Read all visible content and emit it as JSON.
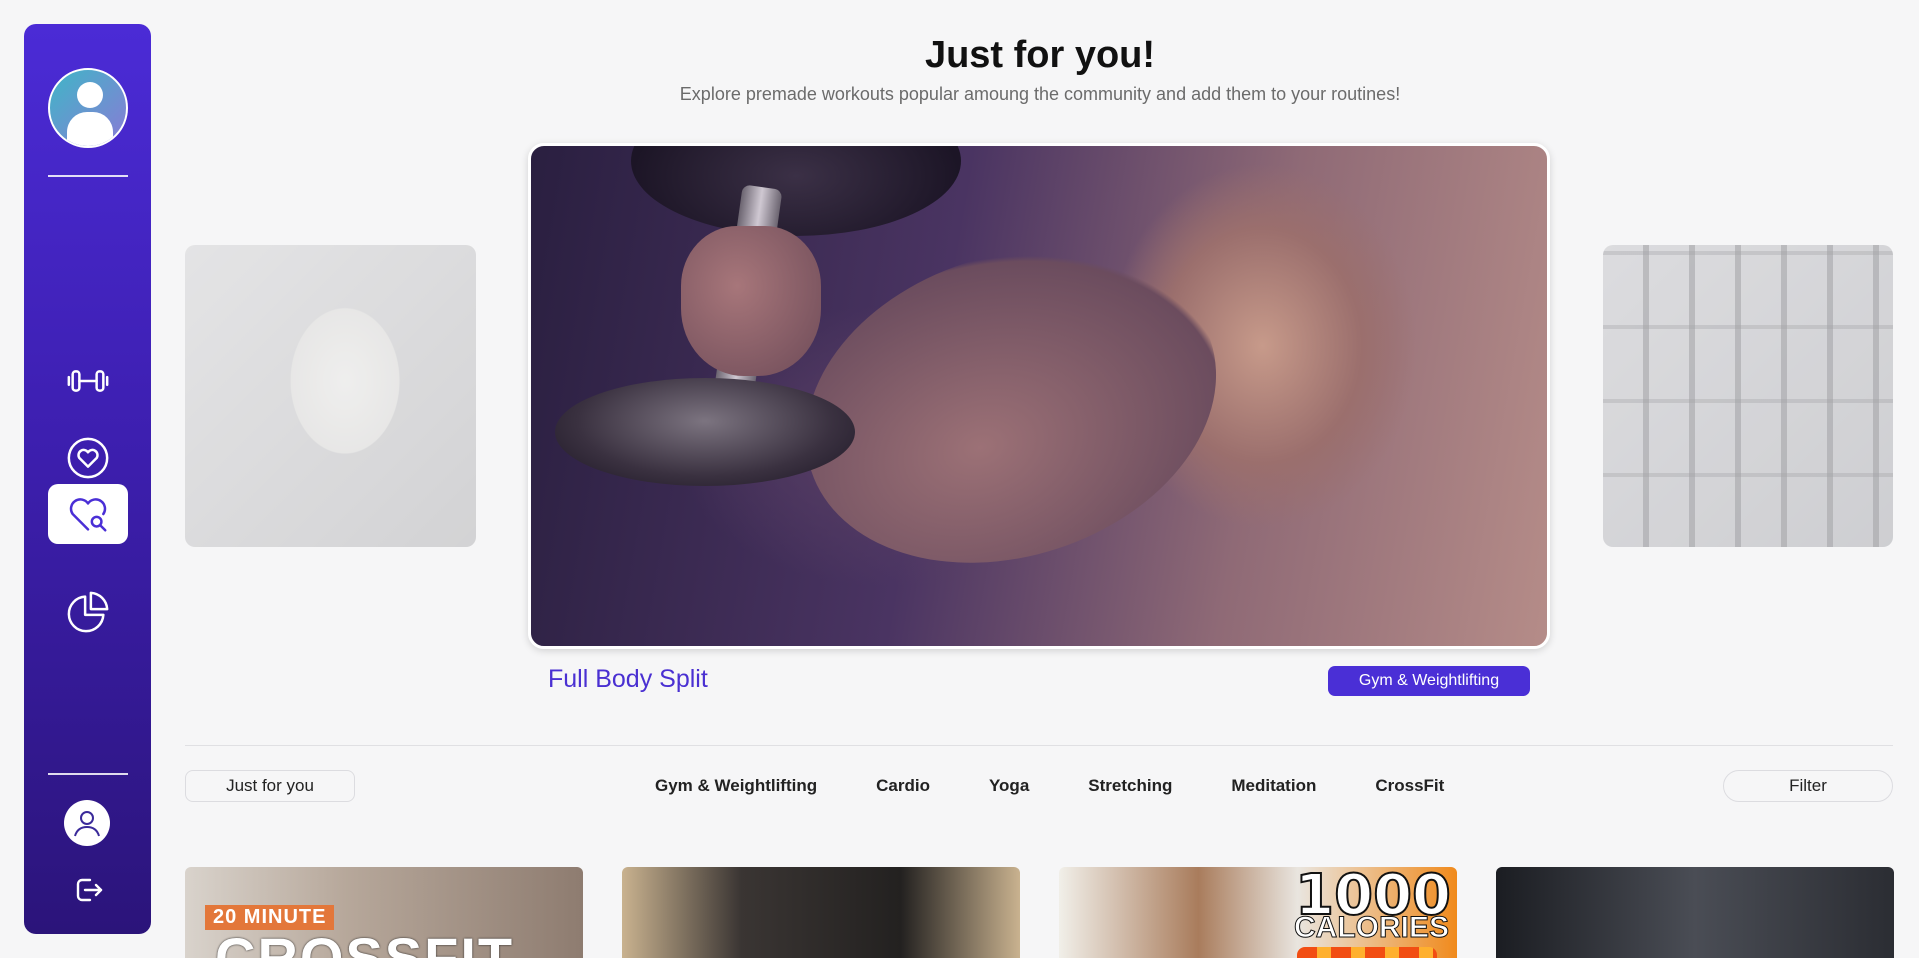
{
  "header": {
    "title": "Just for you!",
    "subtitle": "Explore premade workouts popular amoung the community and add them to your routines!"
  },
  "sidebar": {
    "items": [
      {
        "name": "workouts",
        "icon": "dumbbell-icon"
      },
      {
        "name": "favorites",
        "icon": "heart-circle-icon"
      },
      {
        "name": "explore",
        "icon": "heart-search-icon",
        "active": true
      },
      {
        "name": "stats",
        "icon": "pie-chart-icon"
      }
    ],
    "profile_icon": "user-icon",
    "logout_icon": "logout-icon"
  },
  "carousel": {
    "featured": {
      "name": "Full Body Split",
      "category": "Gym & Weightlifting"
    }
  },
  "filters": {
    "just_for_you": "Just for you",
    "categories": [
      "Gym & Weightlifting",
      "Cardio",
      "Yoga",
      "Stretching",
      "Meditation",
      "CrossFit"
    ],
    "filter_label": "Filter"
  },
  "cards": [
    {
      "badge": "20 MINUTE",
      "title": "CROSSFIT"
    },
    {},
    {
      "title": "1000",
      "subtitle": "CALORIES"
    },
    {}
  ],
  "colors": {
    "accent": "#4a2fd6",
    "sidebar_top": "#4b2bd6",
    "sidebar_bottom": "#2b147a",
    "background": "#f6f6f7"
  }
}
